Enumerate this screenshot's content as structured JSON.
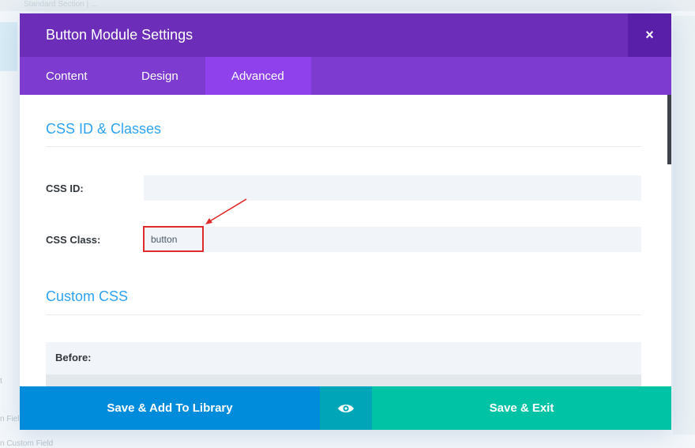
{
  "background": {
    "breadcrumb": "Standard Section  |  ...",
    "side_texts": [
      "t",
      "n Fiel",
      "n Custom Field"
    ]
  },
  "modal": {
    "title": "Button Module Settings",
    "close_symbol": "×",
    "tabs": [
      {
        "label": "Content",
        "active": false
      },
      {
        "label": "Design",
        "active": false
      },
      {
        "label": "Advanced",
        "active": true
      }
    ],
    "sections": {
      "css_id_classes": {
        "title": "CSS ID & Classes",
        "css_id_label": "CSS ID:",
        "css_id_value": "",
        "css_class_label": "CSS Class:",
        "css_class_value": "button"
      },
      "custom_css": {
        "title": "Custom CSS",
        "before_label": "Before:"
      }
    },
    "footer": {
      "save_library_label": "Save & Add To Library",
      "preview_icon": "eye-icon",
      "save_exit_label": "Save & Exit"
    }
  },
  "colors": {
    "header": "#6c2eb9",
    "tabs": "#7e3bd0",
    "active_tab": "#8f42ec",
    "section_title": "#2ea3f2",
    "library_button": "#008bdb",
    "preview_button": "#00a6b8",
    "exit_button": "#00c3a5",
    "annotation": "#e02b2b"
  }
}
